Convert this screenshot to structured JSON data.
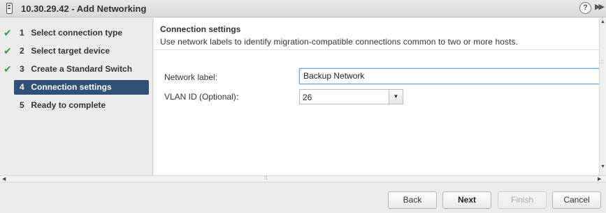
{
  "window": {
    "title": "10.30.29.42 - Add Networking",
    "help_icon": "?",
    "expand_icon": "▶▶"
  },
  "steps": [
    {
      "num": "1",
      "label": "Select connection type",
      "done": true
    },
    {
      "num": "2",
      "label": "Select target device",
      "done": true
    },
    {
      "num": "3",
      "label": "Create a Standard Switch",
      "done": true
    },
    {
      "num": "4",
      "label": "Connection settings",
      "active": true
    },
    {
      "num": "5",
      "label": "Ready to complete"
    }
  ],
  "check_glyph": "✔",
  "content": {
    "title": "Connection settings",
    "description": "Use network labels to identify migration-compatible connections common to two or more hosts.",
    "network_label": {
      "label": "Network label:",
      "value": "Backup Network"
    },
    "vlan_id": {
      "label": "VLAN ID (Optional):",
      "value": "26",
      "arrow": "▼"
    }
  },
  "footer": {
    "back": "Back",
    "next": "Next",
    "finish": "Finish",
    "cancel": "Cancel"
  },
  "colors": {
    "active_step": "#2f5079",
    "check": "#3a9a3a",
    "focus_border": "#6aa3cf"
  },
  "icons": [
    "host-icon",
    "help-icon",
    "expand-icon",
    "check-icon",
    "dropdown-arrow-icon"
  ]
}
